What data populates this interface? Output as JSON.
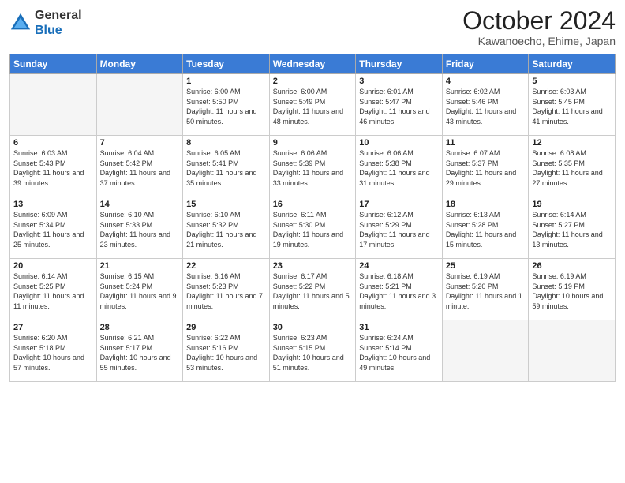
{
  "header": {
    "logo_general": "General",
    "logo_blue": "Blue",
    "month_title": "October 2024",
    "location": "Kawanoecho, Ehime, Japan"
  },
  "weekdays": [
    "Sunday",
    "Monday",
    "Tuesday",
    "Wednesday",
    "Thursday",
    "Friday",
    "Saturday"
  ],
  "weeks": [
    [
      {
        "day": "",
        "empty": true
      },
      {
        "day": "",
        "empty": true
      },
      {
        "day": "1",
        "sunrise": "Sunrise: 6:00 AM",
        "sunset": "Sunset: 5:50 PM",
        "daylight": "Daylight: 11 hours and 50 minutes."
      },
      {
        "day": "2",
        "sunrise": "Sunrise: 6:00 AM",
        "sunset": "Sunset: 5:49 PM",
        "daylight": "Daylight: 11 hours and 48 minutes."
      },
      {
        "day": "3",
        "sunrise": "Sunrise: 6:01 AM",
        "sunset": "Sunset: 5:47 PM",
        "daylight": "Daylight: 11 hours and 46 minutes."
      },
      {
        "day": "4",
        "sunrise": "Sunrise: 6:02 AM",
        "sunset": "Sunset: 5:46 PM",
        "daylight": "Daylight: 11 hours and 43 minutes."
      },
      {
        "day": "5",
        "sunrise": "Sunrise: 6:03 AM",
        "sunset": "Sunset: 5:45 PM",
        "daylight": "Daylight: 11 hours and 41 minutes."
      }
    ],
    [
      {
        "day": "6",
        "sunrise": "Sunrise: 6:03 AM",
        "sunset": "Sunset: 5:43 PM",
        "daylight": "Daylight: 11 hours and 39 minutes."
      },
      {
        "day": "7",
        "sunrise": "Sunrise: 6:04 AM",
        "sunset": "Sunset: 5:42 PM",
        "daylight": "Daylight: 11 hours and 37 minutes."
      },
      {
        "day": "8",
        "sunrise": "Sunrise: 6:05 AM",
        "sunset": "Sunset: 5:41 PM",
        "daylight": "Daylight: 11 hours and 35 minutes."
      },
      {
        "day": "9",
        "sunrise": "Sunrise: 6:06 AM",
        "sunset": "Sunset: 5:39 PM",
        "daylight": "Daylight: 11 hours and 33 minutes."
      },
      {
        "day": "10",
        "sunrise": "Sunrise: 6:06 AM",
        "sunset": "Sunset: 5:38 PM",
        "daylight": "Daylight: 11 hours and 31 minutes."
      },
      {
        "day": "11",
        "sunrise": "Sunrise: 6:07 AM",
        "sunset": "Sunset: 5:37 PM",
        "daylight": "Daylight: 11 hours and 29 minutes."
      },
      {
        "day": "12",
        "sunrise": "Sunrise: 6:08 AM",
        "sunset": "Sunset: 5:35 PM",
        "daylight": "Daylight: 11 hours and 27 minutes."
      }
    ],
    [
      {
        "day": "13",
        "sunrise": "Sunrise: 6:09 AM",
        "sunset": "Sunset: 5:34 PM",
        "daylight": "Daylight: 11 hours and 25 minutes."
      },
      {
        "day": "14",
        "sunrise": "Sunrise: 6:10 AM",
        "sunset": "Sunset: 5:33 PM",
        "daylight": "Daylight: 11 hours and 23 minutes."
      },
      {
        "day": "15",
        "sunrise": "Sunrise: 6:10 AM",
        "sunset": "Sunset: 5:32 PM",
        "daylight": "Daylight: 11 hours and 21 minutes."
      },
      {
        "day": "16",
        "sunrise": "Sunrise: 6:11 AM",
        "sunset": "Sunset: 5:30 PM",
        "daylight": "Daylight: 11 hours and 19 minutes."
      },
      {
        "day": "17",
        "sunrise": "Sunrise: 6:12 AM",
        "sunset": "Sunset: 5:29 PM",
        "daylight": "Daylight: 11 hours and 17 minutes."
      },
      {
        "day": "18",
        "sunrise": "Sunrise: 6:13 AM",
        "sunset": "Sunset: 5:28 PM",
        "daylight": "Daylight: 11 hours and 15 minutes."
      },
      {
        "day": "19",
        "sunrise": "Sunrise: 6:14 AM",
        "sunset": "Sunset: 5:27 PM",
        "daylight": "Daylight: 11 hours and 13 minutes."
      }
    ],
    [
      {
        "day": "20",
        "sunrise": "Sunrise: 6:14 AM",
        "sunset": "Sunset: 5:25 PM",
        "daylight": "Daylight: 11 hours and 11 minutes."
      },
      {
        "day": "21",
        "sunrise": "Sunrise: 6:15 AM",
        "sunset": "Sunset: 5:24 PM",
        "daylight": "Daylight: 11 hours and 9 minutes."
      },
      {
        "day": "22",
        "sunrise": "Sunrise: 6:16 AM",
        "sunset": "Sunset: 5:23 PM",
        "daylight": "Daylight: 11 hours and 7 minutes."
      },
      {
        "day": "23",
        "sunrise": "Sunrise: 6:17 AM",
        "sunset": "Sunset: 5:22 PM",
        "daylight": "Daylight: 11 hours and 5 minutes."
      },
      {
        "day": "24",
        "sunrise": "Sunrise: 6:18 AM",
        "sunset": "Sunset: 5:21 PM",
        "daylight": "Daylight: 11 hours and 3 minutes."
      },
      {
        "day": "25",
        "sunrise": "Sunrise: 6:19 AM",
        "sunset": "Sunset: 5:20 PM",
        "daylight": "Daylight: 11 hours and 1 minute."
      },
      {
        "day": "26",
        "sunrise": "Sunrise: 6:19 AM",
        "sunset": "Sunset: 5:19 PM",
        "daylight": "Daylight: 10 hours and 59 minutes."
      }
    ],
    [
      {
        "day": "27",
        "sunrise": "Sunrise: 6:20 AM",
        "sunset": "Sunset: 5:18 PM",
        "daylight": "Daylight: 10 hours and 57 minutes."
      },
      {
        "day": "28",
        "sunrise": "Sunrise: 6:21 AM",
        "sunset": "Sunset: 5:17 PM",
        "daylight": "Daylight: 10 hours and 55 minutes."
      },
      {
        "day": "29",
        "sunrise": "Sunrise: 6:22 AM",
        "sunset": "Sunset: 5:16 PM",
        "daylight": "Daylight: 10 hours and 53 minutes."
      },
      {
        "day": "30",
        "sunrise": "Sunrise: 6:23 AM",
        "sunset": "Sunset: 5:15 PM",
        "daylight": "Daylight: 10 hours and 51 minutes."
      },
      {
        "day": "31",
        "sunrise": "Sunrise: 6:24 AM",
        "sunset": "Sunset: 5:14 PM",
        "daylight": "Daylight: 10 hours and 49 minutes."
      },
      {
        "day": "",
        "empty": true
      },
      {
        "day": "",
        "empty": true
      }
    ]
  ]
}
